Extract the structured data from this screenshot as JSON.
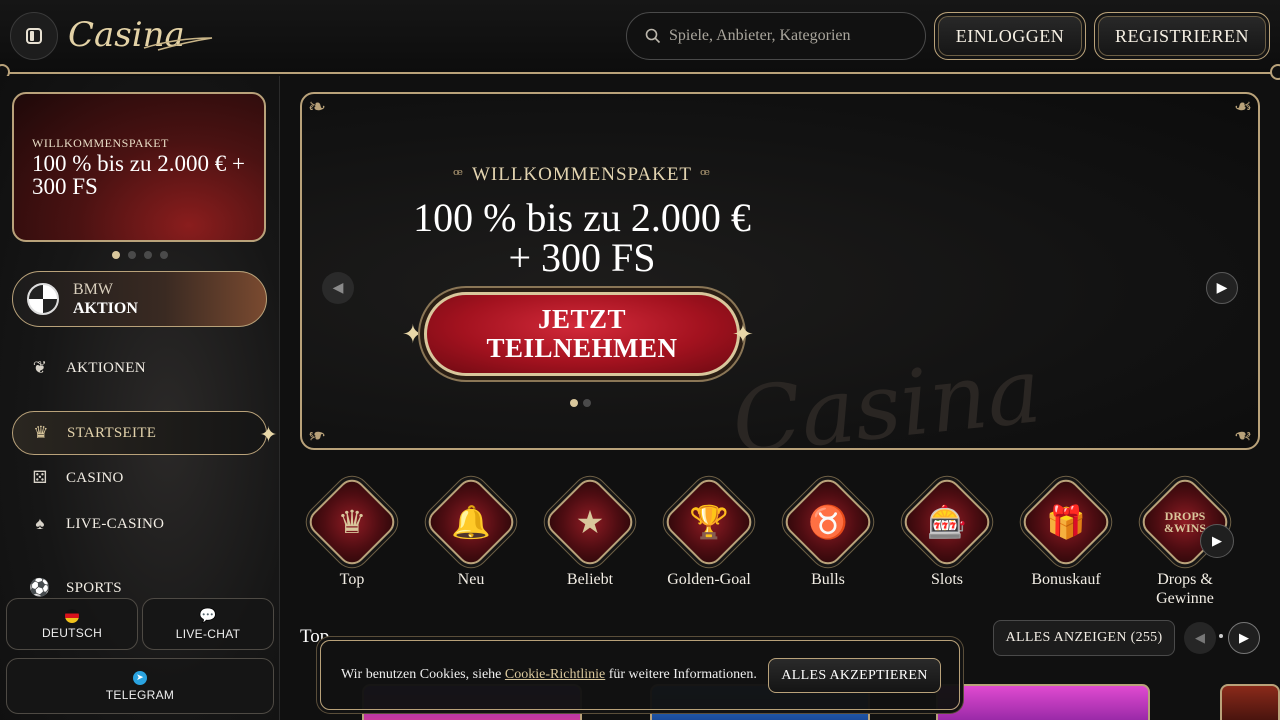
{
  "header": {
    "logo_text": "Casina",
    "search_placeholder": "Spiele, Anbieter, Kategorien",
    "login_label": "EINLOGGEN",
    "register_label": "REGISTRIEREN"
  },
  "sidebar": {
    "promo": {
      "kicker": "WILLKOMMENSPAKET",
      "headline": "100 % bis zu 2.000 € + 300 FS"
    },
    "promo_dots": 4,
    "promo_active_dot": 0,
    "bmw": {
      "line1": "BMW",
      "line2": "AKTION"
    },
    "nav": [
      {
        "label": "AKTIONEN",
        "icon": "tulip-icon"
      },
      {
        "label": "STARTSEITE",
        "icon": "crown-icon",
        "active": true
      },
      {
        "label": "CASINO",
        "icon": "dice-icon"
      },
      {
        "label": "LIVE-CASINO",
        "icon": "cards-icon"
      },
      {
        "label": "SPORTS",
        "icon": "soccer-ball-icon"
      }
    ],
    "bottom": {
      "language": "DEUTSCH",
      "live_chat": "LIVE-CHAT",
      "telegram": "TELEGRAM"
    }
  },
  "hero": {
    "kicker": "WILLKOMMENSPAKET",
    "headline_line1": "100 % bis zu 2.000 €",
    "headline_line2": "+ 300 FS",
    "cta_line1": "JETZT",
    "cta_line2": "TEILNEHMEN",
    "watermark": "Casina",
    "slide_count": 2,
    "active_slide": 0
  },
  "categories": [
    {
      "label": "Top",
      "icon": "crown-icon"
    },
    {
      "label": "Neu",
      "icon": "bell-icon"
    },
    {
      "label": "Beliebt",
      "icon": "star-icon"
    },
    {
      "label": "Golden-Goal",
      "icon": "trophy-icon"
    },
    {
      "label": "Bulls",
      "icon": "bull-icon"
    },
    {
      "label": "Slots",
      "icon": "slot-machine-icon"
    },
    {
      "label": "Bonuskauf",
      "icon": "gift-icon"
    },
    {
      "label": "Drops & Gewinne",
      "icon": "drops-wins-icon"
    }
  ],
  "top_section": {
    "title": "Top",
    "show_all": "ALLES ANZEIGEN (255)"
  },
  "cookie": {
    "text_before": "Wir benutzen Cookies, siehe ",
    "link": "Cookie-Richtlinie",
    "text_after": " für weitere Informationen.",
    "accept": "ALLES AKZEPTIEREN"
  },
  "colors": {
    "gold": "#b9a27a",
    "gold_light": "#d9c79c",
    "cta_red": "#a3121f",
    "background": "#101010"
  }
}
